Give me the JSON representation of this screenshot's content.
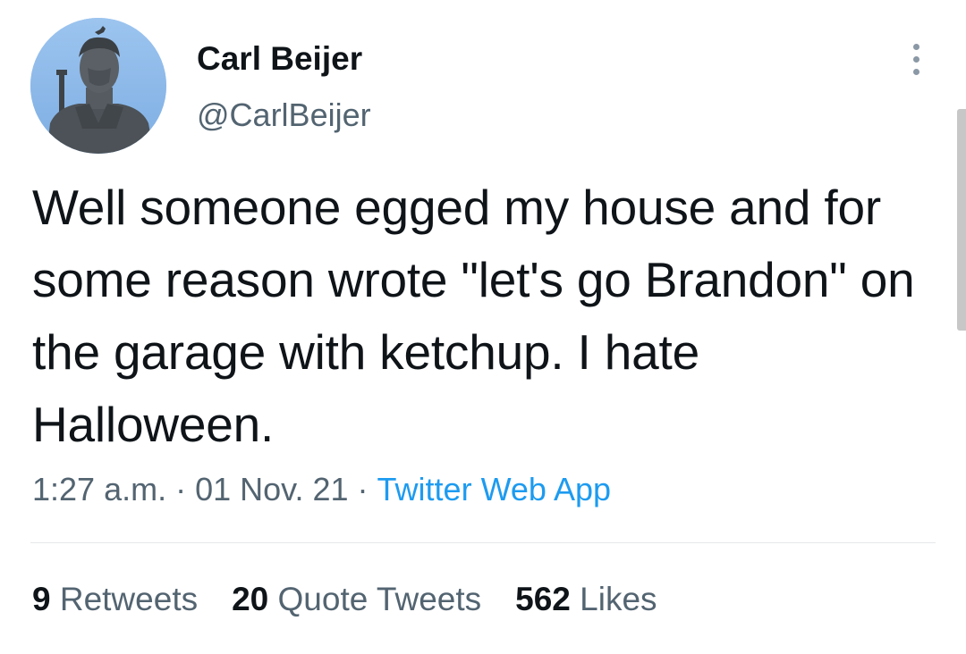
{
  "author": {
    "display_name": "Carl Beijer",
    "handle": "@CarlBeijer"
  },
  "tweet": {
    "text": "Well someone egged my house and for some reason wrote \"let's go Brandon\" on the garage with ketchup. I hate Halloween.",
    "time": "1:27 a.m.",
    "date": "01 Nov. 21",
    "separator": "·",
    "source": "Twitter Web App"
  },
  "stats": [
    {
      "count": "9",
      "label": "Retweets"
    },
    {
      "count": "20",
      "label": "Quote Tweets"
    },
    {
      "count": "562",
      "label": "Likes"
    }
  ],
  "icons": {
    "more": "more-options-icon"
  },
  "colors": {
    "primary_text": "#0f1419",
    "secondary_text": "#536471",
    "link": "#1d9bf0",
    "divider": "#e4e7ea"
  }
}
